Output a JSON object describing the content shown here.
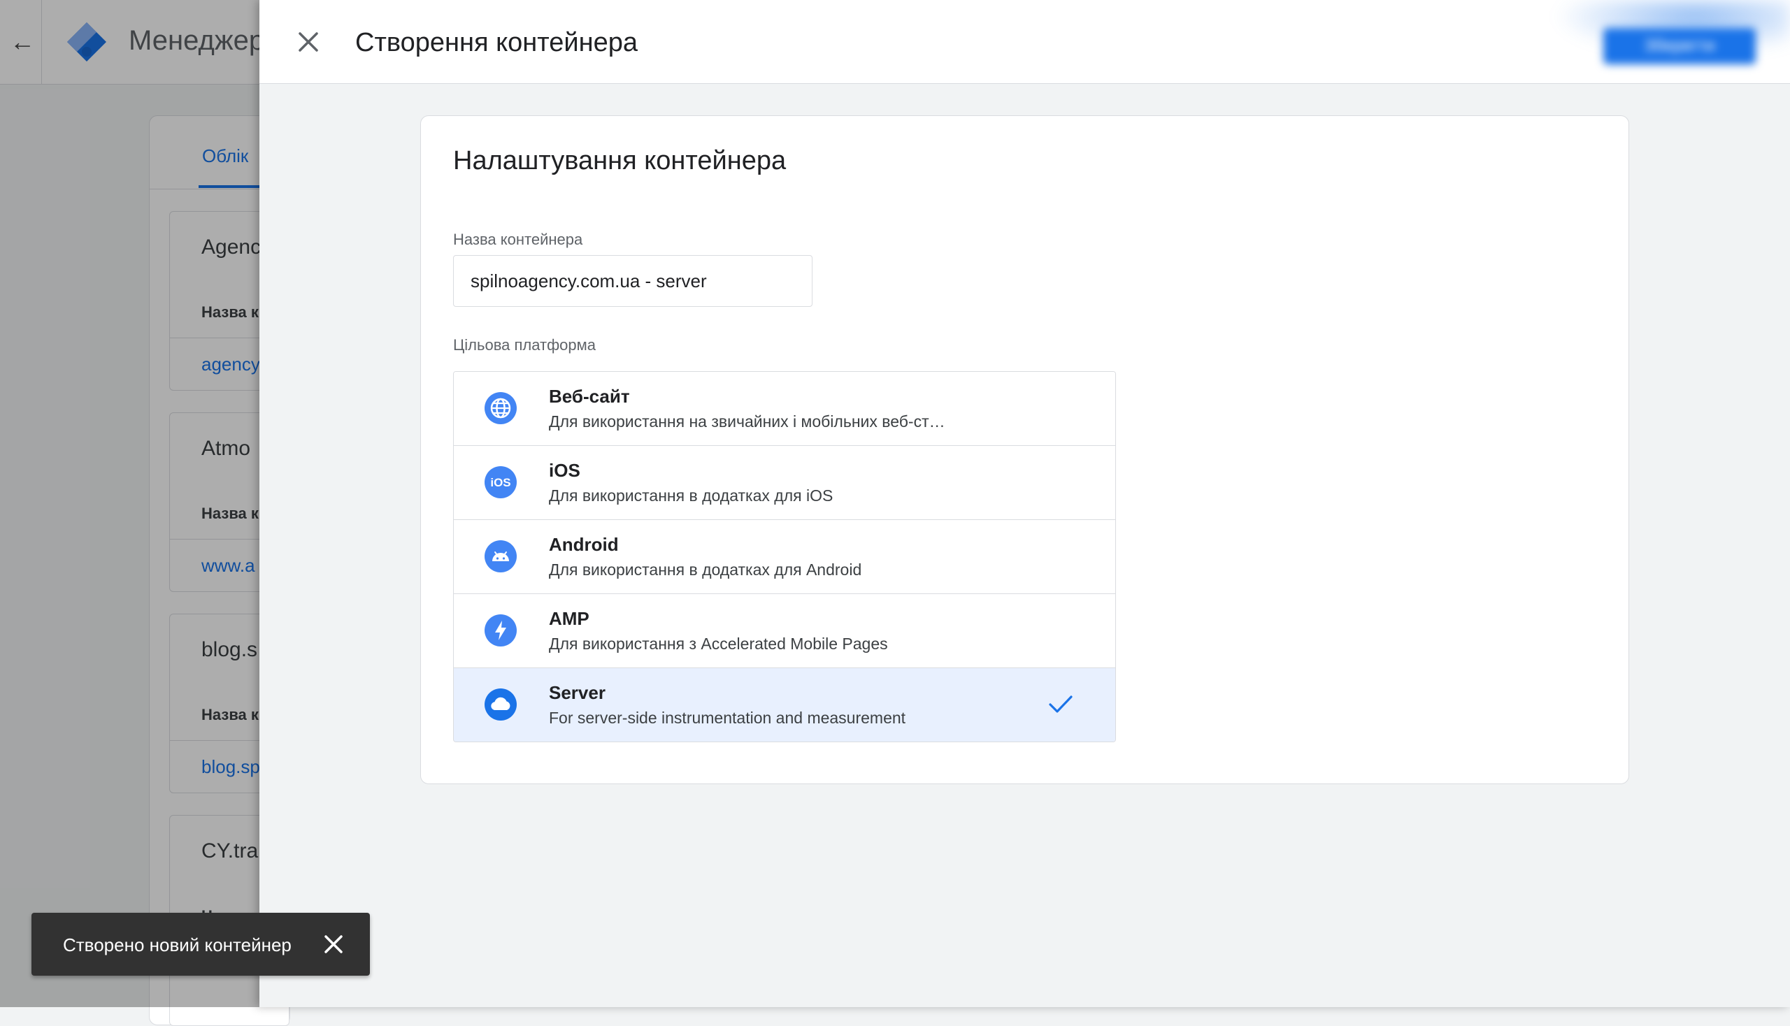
{
  "background": {
    "app_title": "Менеджер",
    "tab_label": "Облік",
    "items": [
      {
        "title": "Agenc",
        "label": "Назва к",
        "link": "agency"
      },
      {
        "title": "Atmo",
        "label": "Назва к",
        "link": "www.a"
      },
      {
        "title": "blog.s",
        "label": "Назва к",
        "link": "blog.sp"
      },
      {
        "title": "CY.tra",
        "label": "Н",
        "link": ""
      }
    ]
  },
  "panel": {
    "title": "Створення контейнера",
    "save_label": "Зберегти"
  },
  "settings": {
    "section_title": "Налаштування контейнера",
    "name_label": "Назва контейнера",
    "name_value": "spilnoagency.com.ua - server",
    "platform_label": "Цільова платформа",
    "platforms": [
      {
        "title": "Веб-сайт",
        "desc": "Для використання на звичайних і мобільних веб-ст…",
        "icon": "globe-icon"
      },
      {
        "title": "iOS",
        "desc": "Для використання в додатках для iOS",
        "icon": "ios-icon"
      },
      {
        "title": "Android",
        "desc": "Для використання в додатках для Android",
        "icon": "android-icon"
      },
      {
        "title": "AMP",
        "desc": "Для використання з Accelerated Mobile Pages",
        "icon": "amp-bolt-icon"
      },
      {
        "title": "Server",
        "desc": "For server-side instrumentation and measurement",
        "icon": "cloud-icon",
        "selected": true
      }
    ]
  },
  "snackbar": {
    "text": "Створено новий контейнер"
  },
  "colors": {
    "accent": "#1a73e8",
    "icon_blue": "#4285f4",
    "selected_bg": "#e8f0fe"
  }
}
